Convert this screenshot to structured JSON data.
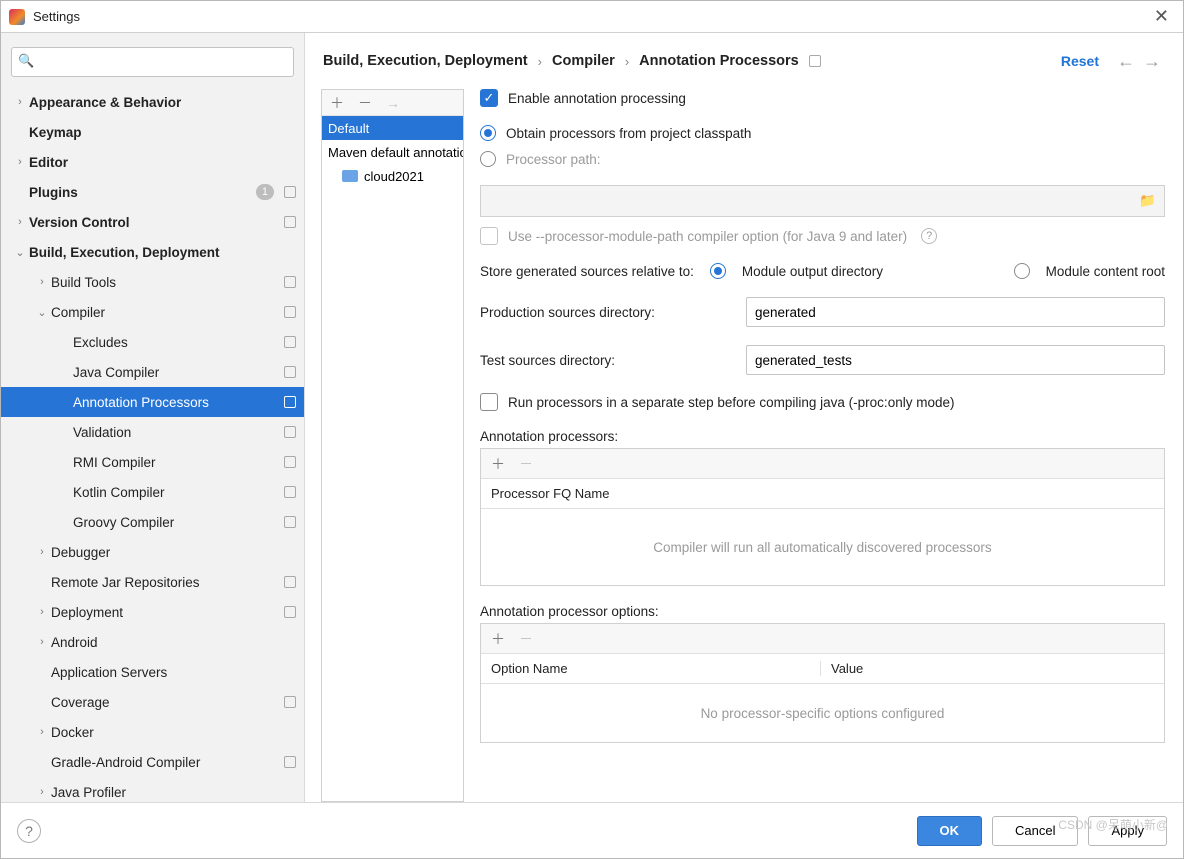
{
  "window": {
    "title": "Settings"
  },
  "search": {
    "placeholder": ""
  },
  "sidebar": {
    "items": [
      {
        "label": "Appearance & Behavior",
        "bold": true,
        "caret": ">",
        "indent": 0
      },
      {
        "label": "Keymap",
        "bold": true,
        "indent": 0
      },
      {
        "label": "Editor",
        "bold": true,
        "caret": ">",
        "indent": 0
      },
      {
        "label": "Plugins",
        "bold": true,
        "indent": 0,
        "count": "1",
        "badge": true
      },
      {
        "label": "Version Control",
        "bold": true,
        "caret": ">",
        "indent": 0,
        "badge": true
      },
      {
        "label": "Build, Execution, Deployment",
        "bold": true,
        "caret": "v",
        "indent": 0
      },
      {
        "label": "Build Tools",
        "caret": ">",
        "indent": 1,
        "badge": true
      },
      {
        "label": "Compiler",
        "caret": "v",
        "indent": 1,
        "badge": true
      },
      {
        "label": "Excludes",
        "indent": 2,
        "badge": true
      },
      {
        "label": "Java Compiler",
        "indent": 2,
        "badge": true
      },
      {
        "label": "Annotation Processors",
        "indent": 2,
        "badge": true,
        "selected": true
      },
      {
        "label": "Validation",
        "indent": 2,
        "badge": true
      },
      {
        "label": "RMI Compiler",
        "indent": 2,
        "badge": true
      },
      {
        "label": "Kotlin Compiler",
        "indent": 2,
        "badge": true
      },
      {
        "label": "Groovy Compiler",
        "indent": 2,
        "badge": true
      },
      {
        "label": "Debugger",
        "caret": ">",
        "indent": 1
      },
      {
        "label": "Remote Jar Repositories",
        "indent": 1,
        "badge": true
      },
      {
        "label": "Deployment",
        "caret": ">",
        "indent": 1,
        "badge": true
      },
      {
        "label": "Android",
        "caret": ">",
        "indent": 1
      },
      {
        "label": "Application Servers",
        "indent": 1
      },
      {
        "label": "Coverage",
        "indent": 1,
        "badge": true
      },
      {
        "label": "Docker",
        "caret": ">",
        "indent": 1
      },
      {
        "label": "Gradle-Android Compiler",
        "indent": 1,
        "badge": true
      },
      {
        "label": "Java Profiler",
        "caret": ">",
        "indent": 1
      }
    ]
  },
  "breadcrumbs": {
    "a": "Build, Execution, Deployment",
    "b": "Compiler",
    "c": "Annotation Processors",
    "reset": "Reset"
  },
  "profiles": {
    "items": [
      {
        "label": "Default",
        "selected": true
      },
      {
        "label": "Maven default annotation processors profile"
      },
      {
        "label": "cloud2021",
        "folder": true
      }
    ]
  },
  "main": {
    "enable": "Enable annotation processing",
    "obtain": "Obtain processors from project classpath",
    "procpath": "Processor path:",
    "modulepath": "Use --processor-module-path compiler option (for Java 9 and later)",
    "store_label": "Store generated sources relative to:",
    "store_a": "Module output directory",
    "store_b": "Module content root",
    "prod_label": "Production sources directory:",
    "prod_value": "generated",
    "test_label": "Test sources directory:",
    "test_value": "generated_tests",
    "runsep": "Run processors in a separate step before compiling java (-proc:only mode)",
    "ap_label": "Annotation processors:",
    "ap_header": "Processor FQ Name",
    "ap_empty": "Compiler will run all automatically discovered processors",
    "apo_label": "Annotation processor options:",
    "apo_h1": "Option Name",
    "apo_h2": "Value",
    "apo_empty": "No processor-specific options configured"
  },
  "buttons": {
    "ok": "OK",
    "cancel": "Cancel",
    "apply": "Apply"
  },
  "watermark": "CSDN @呆萌小新@"
}
